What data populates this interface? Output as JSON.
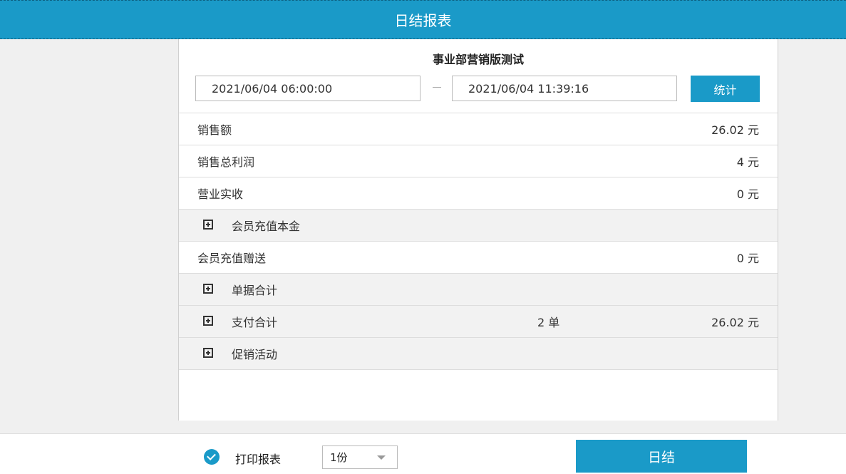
{
  "window": {
    "title": "日结报表"
  },
  "store": {
    "name": "事业部营销版测试"
  },
  "date_range": {
    "start": "2021/06/04 06:00:00",
    "end": "2021/06/04 11:39:16"
  },
  "stat_button": "统计",
  "rows": [
    {
      "label": "销售额",
      "value": "26.02 元",
      "expandable": false
    },
    {
      "label": "销售总利润",
      "value": "4 元",
      "expandable": false
    },
    {
      "label": "营业实收",
      "value": "0 元",
      "expandable": false
    },
    {
      "label": "会员充值本金",
      "value": "",
      "expandable": true
    },
    {
      "label": "会员充值赠送",
      "value": "0 元",
      "expandable": false
    },
    {
      "label": "单据合计",
      "value": "",
      "expandable": true
    },
    {
      "label": "支付合计",
      "count": "2 单",
      "value": "26.02 元",
      "expandable": true
    },
    {
      "label": "促销活动",
      "value": "",
      "expandable": true
    }
  ],
  "footer": {
    "print_label": "打印报表",
    "print_checked": true,
    "copies": "1份",
    "close_button": "日结"
  },
  "colors": {
    "accent": "#1a9ac8"
  }
}
